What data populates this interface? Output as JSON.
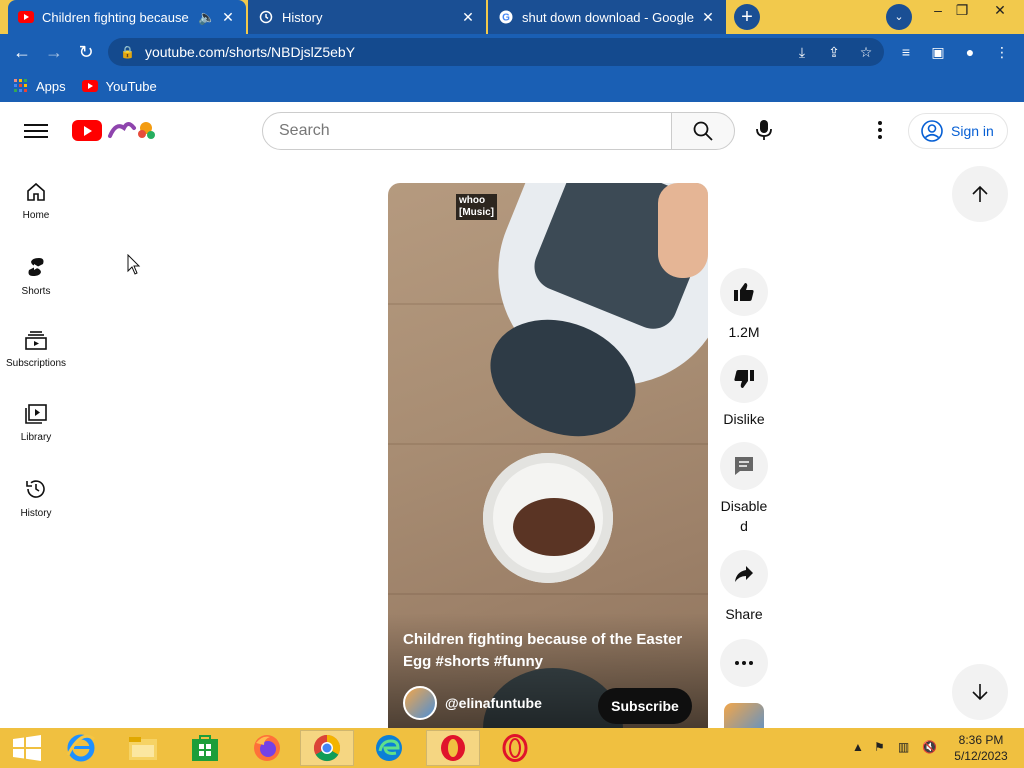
{
  "browser": {
    "tabs": [
      {
        "title": "Children fighting because of",
        "active": true
      },
      {
        "title": "History",
        "active": false
      },
      {
        "title": "shut down download - Google Se",
        "active": false
      }
    ],
    "url": "youtube.com/shorts/NBDjslZ5ebY",
    "bookmarks": [
      {
        "label": "Apps"
      },
      {
        "label": "YouTube"
      }
    ]
  },
  "youtube": {
    "search_placeholder": "Search",
    "signin_label": "Sign in",
    "sidebar": [
      {
        "label": "Home",
        "icon": "home-icon"
      },
      {
        "label": "Shorts",
        "icon": "shorts-icon"
      },
      {
        "label": "Subscriptions",
        "icon": "subscriptions-icon"
      },
      {
        "label": "Library",
        "icon": "library-icon"
      },
      {
        "label": "History",
        "icon": "history-icon"
      }
    ],
    "short": {
      "overlay_tag_line1": "whoo",
      "overlay_tag_line2": "[Music]",
      "title": "Children fighting because of the Easter Egg #shorts #funny",
      "channel": "@elinafuntube",
      "subscribe_label": "Subscribe"
    },
    "actions": {
      "like_count": "1.2M",
      "dislike_label": "Dislike",
      "comments_label": "Disable d",
      "share_label": "Share"
    }
  },
  "taskbar": {
    "time": "8:36 PM",
    "date": "5/12/2023"
  },
  "colors": {
    "chrome_frame": "#1a5fb4",
    "tab_strip": "#f2c94c",
    "youtube_red": "#ff0000",
    "link_blue": "#065fd4",
    "taskbar": "#f0c040"
  }
}
